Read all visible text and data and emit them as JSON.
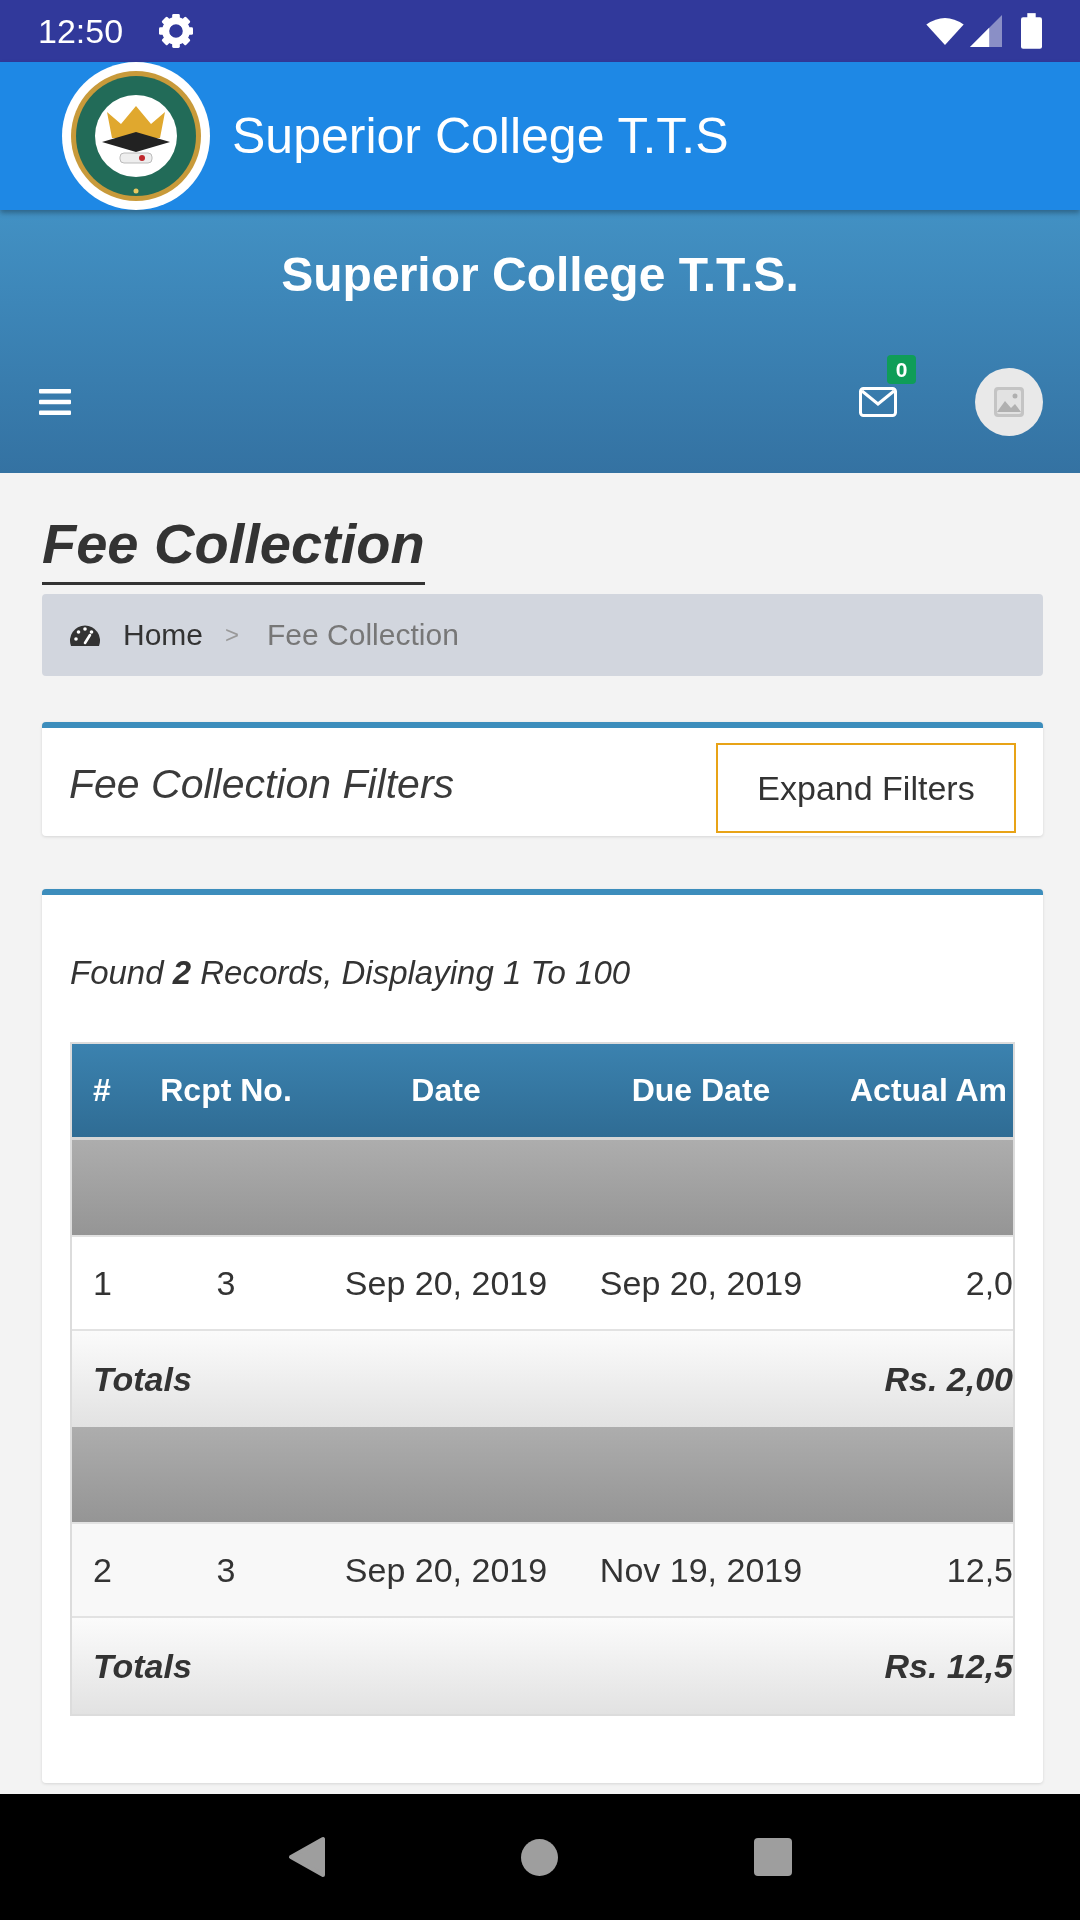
{
  "status_bar": {
    "time": "12:50"
  },
  "app_bar": {
    "title": "Superior College T.T.S"
  },
  "header": {
    "title": "Superior College T.T.S.",
    "message_count": "0"
  },
  "page": {
    "title": "Fee Collection",
    "breadcrumb": {
      "items": [
        {
          "label": "Home",
          "current": false
        },
        {
          "label": "Fee Collection",
          "current": true
        }
      ],
      "separator": ">"
    }
  },
  "filters": {
    "title": "Fee Collection Filters",
    "button": "Expand Filters"
  },
  "results": {
    "summary": "Found **2** Records, Displaying 1 To 100",
    "table": {
      "columns": [
        "#",
        "Rcpt No.",
        "Date",
        "Due Date",
        "Actual Am"
      ],
      "groups": [
        {
          "rows": [
            [
              "1",
              "3",
              "Sep 20, 2019",
              "Sep 20, 2019",
              "2,0"
            ]
          ],
          "totals": {
            "label": "Totals",
            "amount": "Rs. 2,00"
          }
        },
        {
          "rows": [
            [
              "2",
              "3",
              "Sep 20, 2019",
              "Nov 19, 2019",
              "12,5"
            ]
          ],
          "totals": {
            "label": "Totals",
            "amount": "Rs. 12,5"
          }
        }
      ]
    }
  }
}
